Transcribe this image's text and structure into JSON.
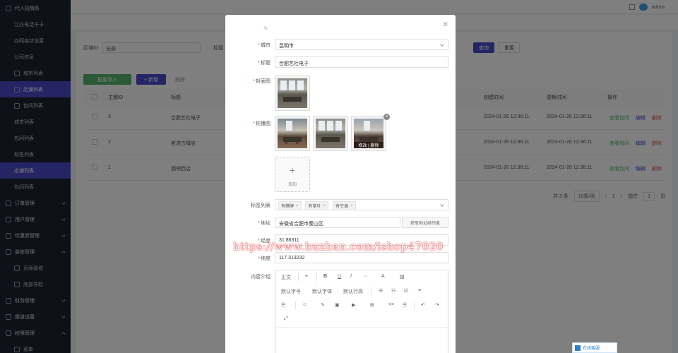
{
  "sidebar": {
    "items": [
      {
        "label": "代人招牌条",
        "level": "top"
      },
      {
        "label": "江办电话千卡",
        "level": "sub-noicon"
      },
      {
        "label": "办网格状设置",
        "level": "sub-noicon"
      },
      {
        "label": "公司信息",
        "level": "sub-noicon"
      },
      {
        "label": "城市列表",
        "level": "sub"
      },
      {
        "label": "店铺列表",
        "level": "sub",
        "active": true
      },
      {
        "label": "包间列表",
        "level": "sub"
      },
      {
        "label": "城市列表",
        "level": "plain"
      },
      {
        "label": "包间列表",
        "level": "plain"
      },
      {
        "label": "标签列表",
        "level": "plain"
      },
      {
        "label": "店铺列表",
        "level": "plain",
        "active": true
      },
      {
        "label": "包间列表",
        "level": "plain"
      },
      {
        "label": "订单管理",
        "level": "top",
        "chev": "down"
      },
      {
        "label": "用户管理",
        "level": "top",
        "chev": "down"
      },
      {
        "label": "优惠券管理",
        "level": "top",
        "chev": "down"
      },
      {
        "label": "装修管理",
        "level": "top",
        "chev": "up"
      },
      {
        "label": "页面装修",
        "level": "sub"
      },
      {
        "label": "底部导航",
        "level": "sub"
      },
      {
        "label": "财务管理",
        "level": "top",
        "chev": "down"
      },
      {
        "label": "渠道设置",
        "level": "top",
        "chev": "down"
      },
      {
        "label": "权限管理",
        "level": "top",
        "chev": "up"
      },
      {
        "label": "菜单",
        "level": "sub"
      }
    ]
  },
  "topbar": {
    "user": "admin"
  },
  "filter": {
    "label": "区域ID",
    "select_value": "全部",
    "label2": "标题"
  },
  "actions": {
    "search": "查询",
    "reset": "重置",
    "import": "批量导入",
    "add": "+ 新增",
    "delete": "删除"
  },
  "table": {
    "headers": [
      "主键ID",
      "标题",
      "创建时间",
      "更新时间",
      "操作"
    ],
    "rows": [
      {
        "id": "3",
        "title": "合肥艺社电子",
        "created": "2024-01-26 12:36:11",
        "updated": "2024-01-26 12:36:11"
      },
      {
        "id": "2",
        "title": "老渣古镇店",
        "created": "2024-01-26 12:36:11",
        "updated": "2024-01-26 12:36:11"
      },
      {
        "id": "1",
        "title": "酒吧西店",
        "created": "2024-01-26 12:36:11",
        "updated": "2024-01-26 12:36:11"
      }
    ],
    "row_actions": {
      "view": "查看包间",
      "edit": "编辑",
      "delete": "删除"
    }
  },
  "pager": {
    "total": "共 3 条",
    "page_size": "10条/页",
    "page": "1",
    "goto_label": "前往",
    "goto_value": "1",
    "goto_suffix": "页"
  },
  "modal": {
    "city_label": "城市",
    "city_value": "昆明市",
    "title_label": "标题",
    "title_value": "合肥艺社电子",
    "cover_label": "封面图",
    "carousel_label": "轮播图",
    "carousel_edit_overlay": "修改 | 删除",
    "add_label": "添加",
    "tags_label": "标签列表",
    "tags": [
      "有棋牌",
      "有茶叶",
      "有空调"
    ],
    "address_label": "地址",
    "address_value": "安徽省合肥市蜀山区",
    "address_button": "获取地址经纬度",
    "lat_label": "经度",
    "lat_value": "31.86311",
    "lng_label": "纬度",
    "lng_value": "117.313232",
    "content_label": "内容介绍",
    "toolbar": {
      "row1": [
        "正文",
        "❝",
        "B",
        "U",
        "I",
        "···",
        "A",
        "▨"
      ],
      "row2": [
        "默认字号",
        "默认字体",
        "默认行高",
        "☰",
        "☷",
        "☑",
        "≡"
      ],
      "row3": [
        "☰",
        "☺",
        "✎",
        "▣",
        "▶",
        "⊞",
        "<>",
        "☰",
        "↶",
        "↷"
      ],
      "row4": [
        "⤢"
      ]
    }
  },
  "watermark": "https://www.huzhan.com/ishop47020",
  "corner_badge": "在线客服"
}
